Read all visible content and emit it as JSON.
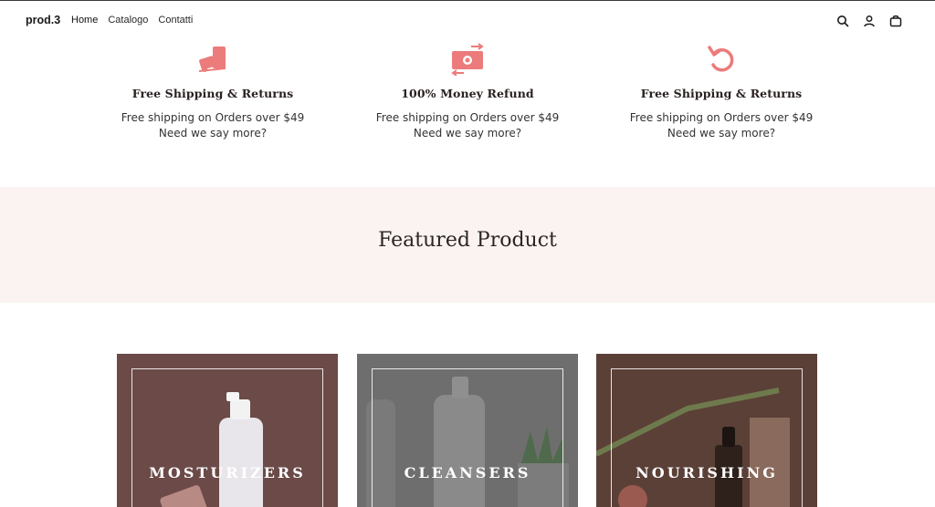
{
  "header": {
    "brand": "prod.3",
    "nav": [
      "Home",
      "Catalogo",
      "Contatti"
    ],
    "icons": [
      "search-icon",
      "account-icon",
      "cart-icon"
    ]
  },
  "features": [
    {
      "icon": "shipping-truck-icon",
      "title": "Free Shipping & Returns",
      "line1": "Free shipping on Orders over $49",
      "line2": "Need we say more?"
    },
    {
      "icon": "money-refund-icon",
      "title": "100% Money Refund",
      "line1": "Free shipping on Orders over $49",
      "line2": "Need we say more?"
    },
    {
      "icon": "return-arrow-icon",
      "title": "Free Shipping & Returns",
      "line1": "Free shipping on Orders over $49",
      "line2": "Need we say more?"
    }
  ],
  "featured": {
    "heading": "Featured Product"
  },
  "categories": [
    {
      "label": "MOSTURIZERS",
      "color": "#6b4a48"
    },
    {
      "label": "CLEANSERS",
      "color": "#6e6e6e"
    },
    {
      "label": "NOURISHING",
      "color": "#5b4037"
    }
  ],
  "colors": {
    "accent": "#ec7b7b",
    "band": "#faf3f1"
  }
}
